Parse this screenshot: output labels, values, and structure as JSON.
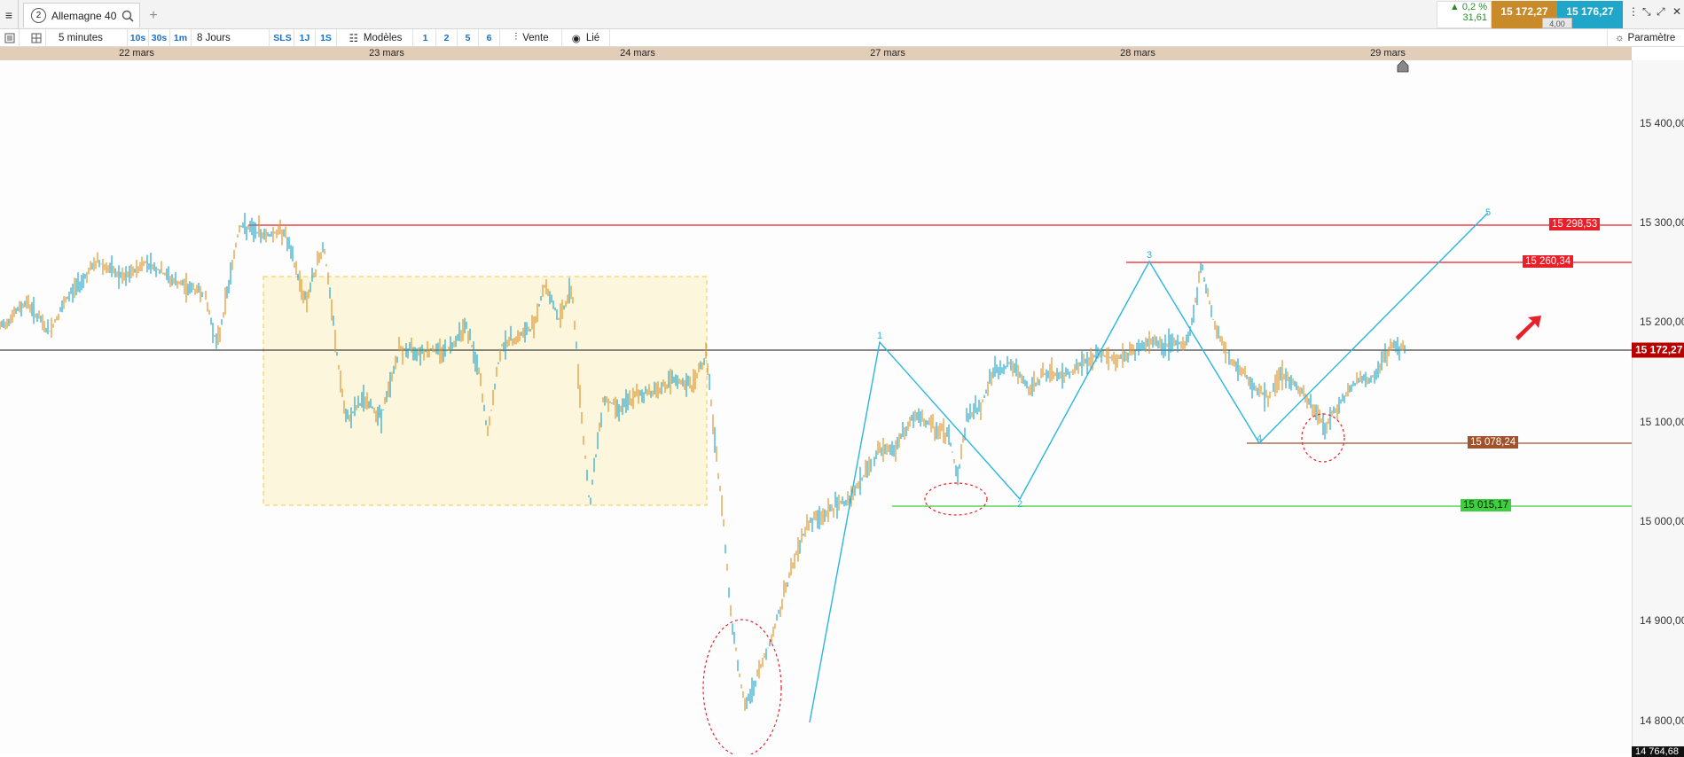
{
  "header": {
    "menu_icon": "hamburger-icon",
    "instrument_number": "2",
    "instrument_name": "Allemagne 40",
    "add_tab": "+",
    "change_pct": "▲ 0,2 %",
    "change_pts": "31,61",
    "bid": "15 172,27",
    "ask": "15 176,27",
    "spread": "4,00"
  },
  "toolbar": {
    "timeframe": "5 minutes",
    "tf_buttons": [
      "10s",
      "30s",
      "1m"
    ],
    "period": "8 Jours",
    "quick_buttons": [
      "SLS",
      "1J",
      "1S"
    ],
    "models_label": "Modèles",
    "num_buttons": [
      "1",
      "2",
      "5",
      "6"
    ],
    "sell_label": "Vente",
    "linked_label": "Lié",
    "params_label": "Paramètre"
  },
  "dates": [
    "22 mars",
    "23 mars",
    "24 mars",
    "27 mars",
    "28 mars",
    "29 mars"
  ],
  "axis": {
    "labels": [
      "15 400,00",
      "15 300,00",
      "15 200,00",
      "15 100,00",
      "15 000,00",
      "14 900,00",
      "14 800,00"
    ],
    "current_price": "15 172,27",
    "min_price": "14 764,68"
  },
  "levels": {
    "resistance_top": "15 298,53",
    "resistance_mid": "15 260,34",
    "support_high": "15 078,24",
    "support_low": "15 015,17"
  },
  "wave_labels": [
    "1",
    "2",
    "3",
    "4",
    "5"
  ],
  "colors": {
    "candles_up": "#2aa7c9",
    "candles_down": "#e0962f",
    "wave_line": "#29b6e0",
    "resistance": "#e8202a",
    "support_low": "#3ecf3e",
    "support_high": "#a0522d",
    "range_box": "#fbf6dc"
  }
}
